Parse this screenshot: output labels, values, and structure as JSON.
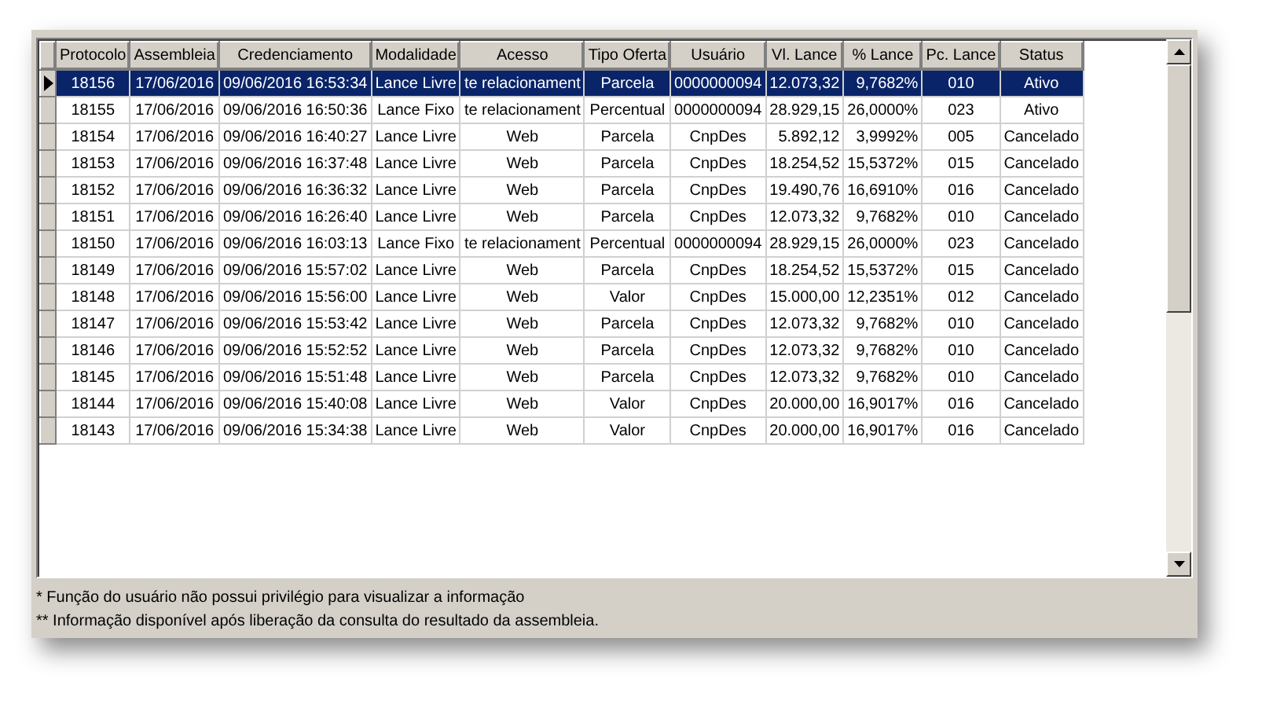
{
  "table": {
    "columns": [
      "Protocolo",
      "Assembleia",
      "Credenciamento",
      "Modalidade",
      "Acesso",
      "Tipo Oferta",
      "Usuário",
      "Vl. Lance",
      "% Lance",
      "Pc. Lance",
      "Status"
    ],
    "rows": [
      {
        "selected": true,
        "cells": [
          "18156",
          "17/06/2016",
          "09/06/2016 16:53:34",
          "Lance Livre",
          "te relacionament",
          "Parcela",
          "0000000094",
          "12.073,32",
          "9,7682%",
          "010",
          "Ativo"
        ]
      },
      {
        "selected": false,
        "cells": [
          "18155",
          "17/06/2016",
          "09/06/2016 16:50:36",
          "Lance Fixo",
          "te relacionament",
          "Percentual",
          "0000000094",
          "28.929,15",
          "26,0000%",
          "023",
          "Ativo"
        ]
      },
      {
        "selected": false,
        "cells": [
          "18154",
          "17/06/2016",
          "09/06/2016 16:40:27",
          "Lance Livre",
          "Web",
          "Parcela",
          "CnpDes",
          "5.892,12",
          "3,9992%",
          "005",
          "Cancelado"
        ]
      },
      {
        "selected": false,
        "cells": [
          "18153",
          "17/06/2016",
          "09/06/2016 16:37:48",
          "Lance Livre",
          "Web",
          "Parcela",
          "CnpDes",
          "18.254,52",
          "15,5372%",
          "015",
          "Cancelado"
        ]
      },
      {
        "selected": false,
        "cells": [
          "18152",
          "17/06/2016",
          "09/06/2016 16:36:32",
          "Lance Livre",
          "Web",
          "Parcela",
          "CnpDes",
          "19.490,76",
          "16,6910%",
          "016",
          "Cancelado"
        ]
      },
      {
        "selected": false,
        "cells": [
          "18151",
          "17/06/2016",
          "09/06/2016 16:26:40",
          "Lance Livre",
          "Web",
          "Parcela",
          "CnpDes",
          "12.073,32",
          "9,7682%",
          "010",
          "Cancelado"
        ]
      },
      {
        "selected": false,
        "cells": [
          "18150",
          "17/06/2016",
          "09/06/2016 16:03:13",
          "Lance Fixo",
          "te relacionament",
          "Percentual",
          "0000000094",
          "28.929,15",
          "26,0000%",
          "023",
          "Cancelado"
        ]
      },
      {
        "selected": false,
        "cells": [
          "18149",
          "17/06/2016",
          "09/06/2016 15:57:02",
          "Lance Livre",
          "Web",
          "Parcela",
          "CnpDes",
          "18.254,52",
          "15,5372%",
          "015",
          "Cancelado"
        ]
      },
      {
        "selected": false,
        "cells": [
          "18148",
          "17/06/2016",
          "09/06/2016 15:56:00",
          "Lance Livre",
          "Web",
          "Valor",
          "CnpDes",
          "15.000,00",
          "12,2351%",
          "012",
          "Cancelado"
        ]
      },
      {
        "selected": false,
        "cells": [
          "18147",
          "17/06/2016",
          "09/06/2016 15:53:42",
          "Lance Livre",
          "Web",
          "Parcela",
          "CnpDes",
          "12.073,32",
          "9,7682%",
          "010",
          "Cancelado"
        ]
      },
      {
        "selected": false,
        "cells": [
          "18146",
          "17/06/2016",
          "09/06/2016 15:52:52",
          "Lance Livre",
          "Web",
          "Parcela",
          "CnpDes",
          "12.073,32",
          "9,7682%",
          "010",
          "Cancelado"
        ]
      },
      {
        "selected": false,
        "cells": [
          "18145",
          "17/06/2016",
          "09/06/2016 15:51:48",
          "Lance Livre",
          "Web",
          "Parcela",
          "CnpDes",
          "12.073,32",
          "9,7682%",
          "010",
          "Cancelado"
        ]
      },
      {
        "selected": false,
        "cells": [
          "18144",
          "17/06/2016",
          "09/06/2016 15:40:08",
          "Lance Livre",
          "Web",
          "Valor",
          "CnpDes",
          "20.000,00",
          "16,9017%",
          "016",
          "Cancelado"
        ]
      },
      {
        "selected": false,
        "cells": [
          "18143",
          "17/06/2016",
          "09/06/2016 15:34:38",
          "Lance Livre",
          "Web",
          "Valor",
          "CnpDes",
          "20.000,00",
          "16,9017%",
          "016",
          "Cancelado"
        ]
      }
    ]
  },
  "notes": [
    "* Função do usuário não possui privilégio para visualizar a informação",
    "** Informação disponível após liberação da consulta do resultado da assembleia."
  ]
}
